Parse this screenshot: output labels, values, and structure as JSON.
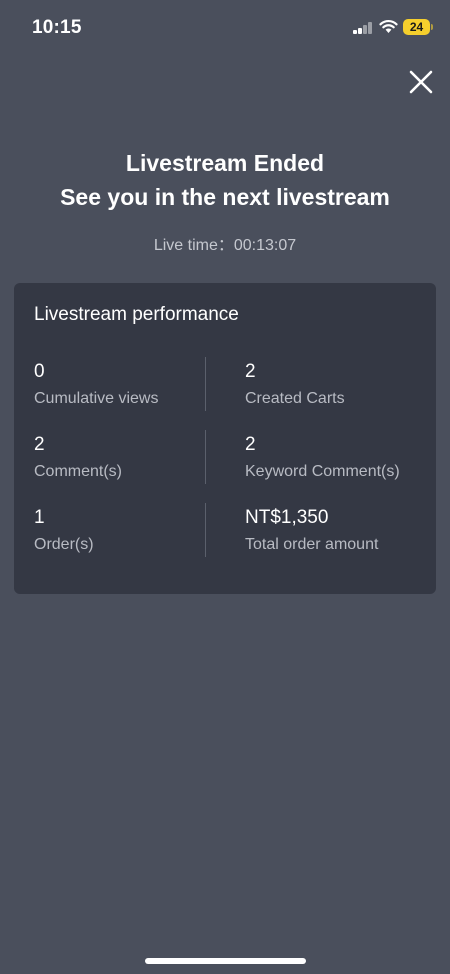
{
  "status_bar": {
    "time": "10:15",
    "battery": "24"
  },
  "header": {
    "title_line1": "Livestream Ended",
    "title_line2": "See you in the next livestream",
    "live_time": "Live time：00:13:07"
  },
  "performance": {
    "title": "Livestream performance",
    "stats": [
      {
        "value": "0",
        "label": "Cumulative views"
      },
      {
        "value": "2",
        "label": "Created Carts"
      },
      {
        "value": "2",
        "label": "Comment(s)"
      },
      {
        "value": "2",
        "label": "Keyword Comment(s)"
      },
      {
        "value": "1",
        "label": "Order(s)"
      },
      {
        "value": "NT$1,350",
        "label": "Total order amount"
      }
    ]
  },
  "icons": {
    "close": "close-icon",
    "signal": "cellular-signal-icon",
    "wifi": "wifi-icon",
    "battery": "battery-icon"
  },
  "colors": {
    "background": "#4a4f5c",
    "card": "#343844",
    "battery": "#f5cf2d"
  }
}
